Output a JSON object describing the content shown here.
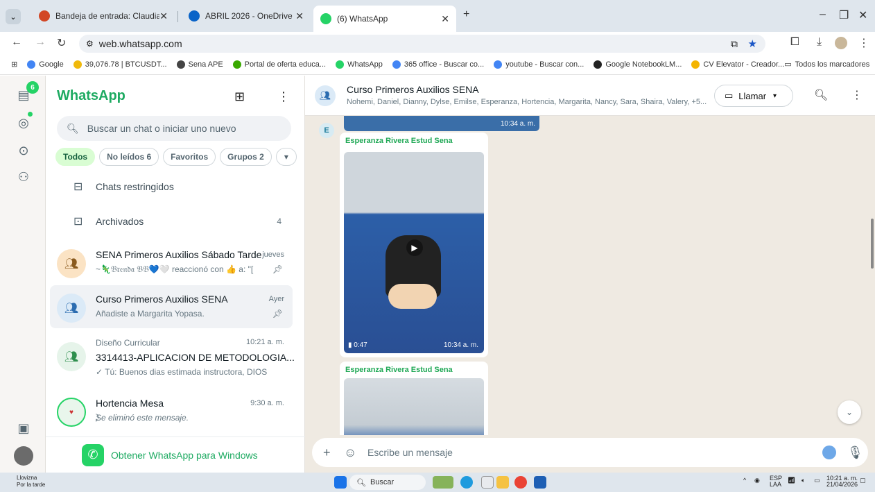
{
  "browser": {
    "tabs": [
      {
        "label": "Bandeja de entrada: Claudia Patric",
        "color": "#d24726"
      },
      {
        "label": "ABRIL 2026 - OneDrive",
        "color": "#0a64c8"
      },
      {
        "label": "(6) WhatsApp",
        "color": "#25d366"
      }
    ],
    "new_tab": "+",
    "url": "web.whatsapp.com",
    "bookmarks": [
      {
        "label": "Google",
        "color": "#4285f4"
      },
      {
        "label": "39,076.78 | BTCUSDT...",
        "color": "#f0b90b"
      },
      {
        "label": "Sena APE",
        "color": "#444444"
      },
      {
        "label": "Portal de oferta educa...",
        "color": "#39a900"
      },
      {
        "label": "WhatsApp",
        "color": "#25d366"
      },
      {
        "label": "365 office - Buscar co...",
        "color": "#4285f4"
      },
      {
        "label": "youtube - Buscar con...",
        "color": "#4285f4"
      },
      {
        "label": "Google NotebookLM...",
        "color": "#222222"
      },
      {
        "label": "CV Elevator - Creador...",
        "color": "#f4b400"
      }
    ],
    "all_bookmarks": "Todos los marcadores"
  },
  "rail": {
    "chats_badge": "6"
  },
  "sidebar": {
    "title": "WhatsApp",
    "search_placeholder": "Buscar un chat o iniciar uno nuevo",
    "filters": [
      {
        "label": "Todos",
        "active": true
      },
      {
        "label": "No leídos 6",
        "active": false
      },
      {
        "label": "Favoritos",
        "active": false
      },
      {
        "label": "Grupos 2",
        "active": false
      }
    ],
    "restricted": "Chats restringidos",
    "archived": "Archivados",
    "archived_count": "4",
    "chats": [
      {
        "name": "SENA Primeros Auxilios Sábado Tarde",
        "time": "jueves",
        "preview": "~🦎𝔅𝔯𝔢𝔫𝔡𝔞 𝔅𝔅💙🤍 reaccionó con 👍 a: \"[",
        "selected": false
      },
      {
        "name": "Curso Primeros Auxilios SENA",
        "time": "Ayer",
        "preview": "Añadiste a Margarita Yopasa.",
        "selected": true
      },
      {
        "community": "Diseño Curricular",
        "name": "3314413-APLICACION DE METODOLOGIA...",
        "time": "10:21 a. m.",
        "preview": "✓ Tú: Buenos dias estimada instructora, DIOS la...",
        "selected": false
      },
      {
        "name": "Hortencia Mesa",
        "time": "9:30 a. m.",
        "preview": "⃠Se eliminó este mensaje.",
        "selected": false
      }
    ],
    "get_app": "Obtener WhatsApp para Windows"
  },
  "conversation": {
    "name": "Curso Primeros Auxilios SENA",
    "members": "Nohemi, Daniel, Dianny, Dylse, Emilse, Esperanza, Hortencia, Margarita, Nancy, Sara, Shaira, Valery, +5...",
    "call_label": "Llamar",
    "top_time": "10:34 a. m.",
    "sender_initial": "E",
    "messages": [
      {
        "sender": "Esperanza Rivera Estud Sena",
        "duration": "0:47",
        "time": "10:34 a. m."
      },
      {
        "sender": "Esperanza Rivera Estud Sena"
      }
    ],
    "composer_placeholder": "Escribe un mensaje"
  },
  "taskbar": {
    "weather_title": "Llovizna",
    "weather_sub": "Por la tarde",
    "search": "Buscar",
    "lang": "ESP",
    "lang_sub": "LAA",
    "time": "10:21 a. m.",
    "date": "21/04/2026"
  }
}
